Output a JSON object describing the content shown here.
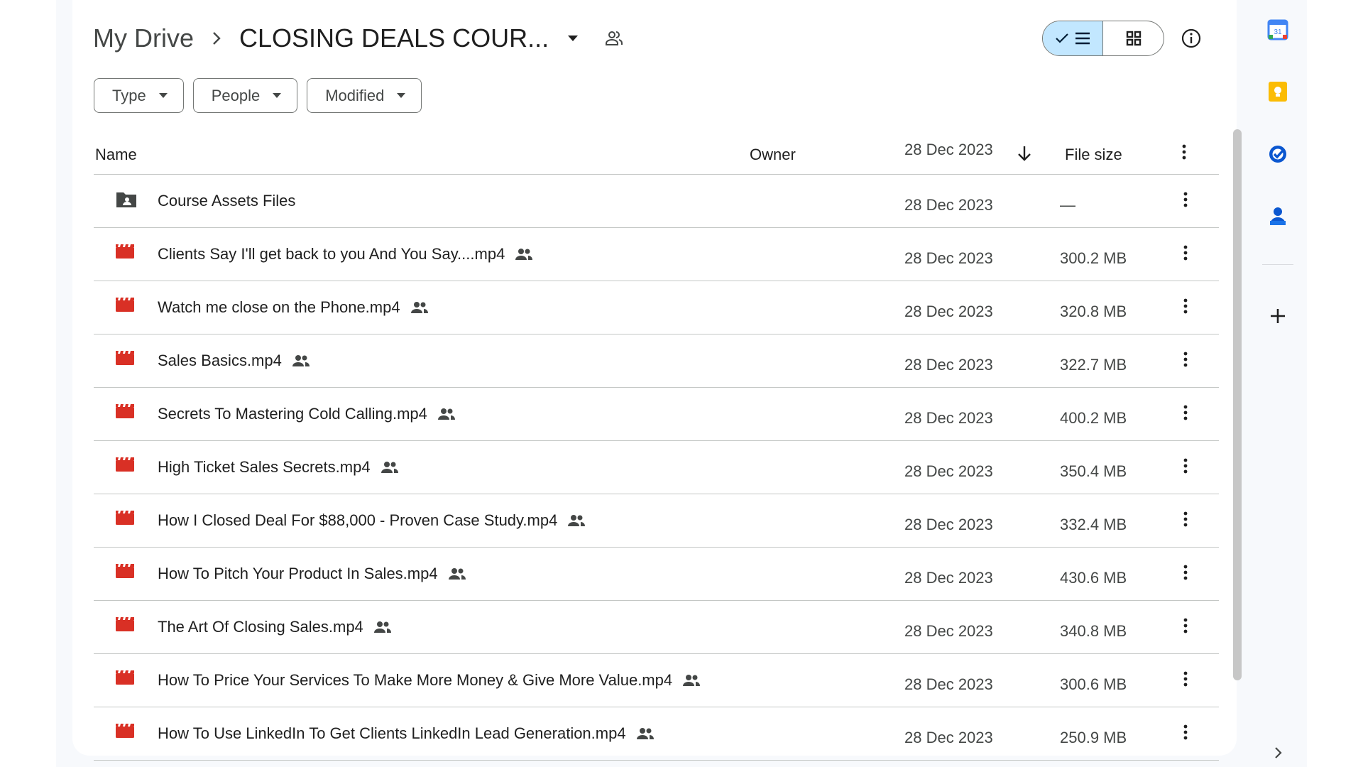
{
  "breadcrumb": {
    "root": "My Drive",
    "current": "CLOSING DEALS COUR..."
  },
  "filters": [
    {
      "label": "Type"
    },
    {
      "label": "People"
    },
    {
      "label": "Modified"
    }
  ],
  "table": {
    "headers": {
      "name": "Name",
      "owner": "Owner",
      "date": "28 Dec 2023",
      "size": "File size"
    },
    "rows": [
      {
        "type": "folder",
        "name": "Course Assets Files",
        "date": "28 Dec 2023",
        "size": "—",
        "shared": false
      },
      {
        "type": "video",
        "name": "Clients Say I'll get back to you And You Say....mp4",
        "date": "28 Dec 2023",
        "size": "300.2 MB",
        "shared": true
      },
      {
        "type": "video",
        "name": "Watch me close on the Phone.mp4",
        "date": "28 Dec 2023",
        "size": "320.8 MB",
        "shared": true
      },
      {
        "type": "video",
        "name": "Sales Basics.mp4",
        "date": "28 Dec 2023",
        "size": "322.7 MB",
        "shared": true
      },
      {
        "type": "video",
        "name": "Secrets To Mastering Cold Calling.mp4",
        "date": "28 Dec 2023",
        "size": "400.2 MB",
        "shared": true
      },
      {
        "type": "video",
        "name": "High Ticket Sales Secrets.mp4",
        "date": "28 Dec 2023",
        "size": "350.4 MB",
        "shared": true
      },
      {
        "type": "video",
        "name": "How I Closed Deal For $88,000 - Proven Case Study.mp4",
        "date": "28 Dec 2023",
        "size": "332.4 MB",
        "shared": true
      },
      {
        "type": "video",
        "name": "How To Pitch Your Product In Sales.mp4",
        "date": "28 Dec 2023",
        "size": "430.6 MB",
        "shared": true
      },
      {
        "type": "video",
        "name": "The Art Of Closing Sales.mp4",
        "date": "28 Dec 2023",
        "size": "340.8 MB",
        "shared": true
      },
      {
        "type": "video",
        "name": "How To Price Your Services To Make More Money & Give More Value.mp4",
        "date": "28 Dec 2023",
        "size": "300.6 MB",
        "shared": true
      },
      {
        "type": "video",
        "name": "How To Use LinkedIn To Get Clients LinkedIn Lead Generation.mp4",
        "date": "28 Dec 2023",
        "size": "250.9 MB",
        "shared": true
      }
    ]
  },
  "side_panel": {
    "calendar_day": "31"
  },
  "colors": {
    "accent": "#0b57d0",
    "view_toggle_active": "#c2e7ff",
    "video_icon": "#d93025",
    "folder_icon": "#444746",
    "keep": "#fbbc04"
  }
}
